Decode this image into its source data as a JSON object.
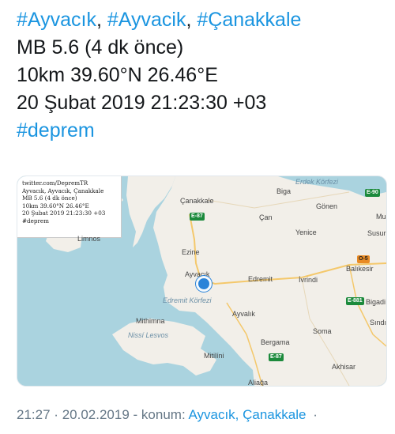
{
  "tweet": {
    "hashtags_line": [
      "#Ayvacık",
      "#Ayvacik",
      "#Çanakkale"
    ],
    "magnitude_line": "MB 5.6 (4 dk önce)",
    "location_line": "10km 39.60°N 26.46°E",
    "datetime_line": "20 Şubat 2019 21:23:30 +03",
    "tag_line": "#deprem"
  },
  "card": {
    "overlay_lines": [
      "twitter.com/DepremTR",
      "Ayvacık, Ayvacık, Çanakkale",
      "MB 5.6 (4 dk önce)",
      "10km 39.60°N 26.46°E",
      "20 Şubat 2019 21:23:30 +03",
      "#deprem"
    ],
    "map_labels": {
      "erdek": "Erdek Körfezi",
      "biga": "Biga",
      "canakkale": "Çanakkale",
      "gonen": "Gönen",
      "can": "Çan",
      "yenice": "Yenice",
      "susurluk": "Susurl",
      "mu": "Mu",
      "ezine": "Ezine",
      "limnos": "Limnos",
      "balikesir": "Balıkesir",
      "ayvacik": "Ayvacık",
      "edremit": "Edremit",
      "ivrindi": "İvrindi",
      "edremit_korfezi": "Edremit Körfezi",
      "bigadic": "Bigadi",
      "mithimna": "Mithimna",
      "ayvalik": "Ayvalık",
      "sindirgi": "Sındı",
      "nissi_lesvos": "Nissí Lesvos",
      "soma": "Soma",
      "bergama": "Bergama",
      "mitilini": "Mitilíni",
      "akhisar": "Akhisar",
      "aliaga": "Aliağa"
    },
    "road_badges": {
      "e90": "E-90",
      "e87_north": "E-87",
      "o5": "O-5",
      "e881": "E-881",
      "e87_south": "E-87"
    },
    "colors": {
      "sea": "#aad3df",
      "land": "#f2efe9",
      "marker": "#2a83d8"
    }
  },
  "footer": {
    "time": "21:27",
    "separator1": "·",
    "date": "20.02.2019",
    "separator2": "-",
    "location_prefix": "konum:",
    "location": "Ayvacık, Çanakkale",
    "end_dot": "·"
  }
}
